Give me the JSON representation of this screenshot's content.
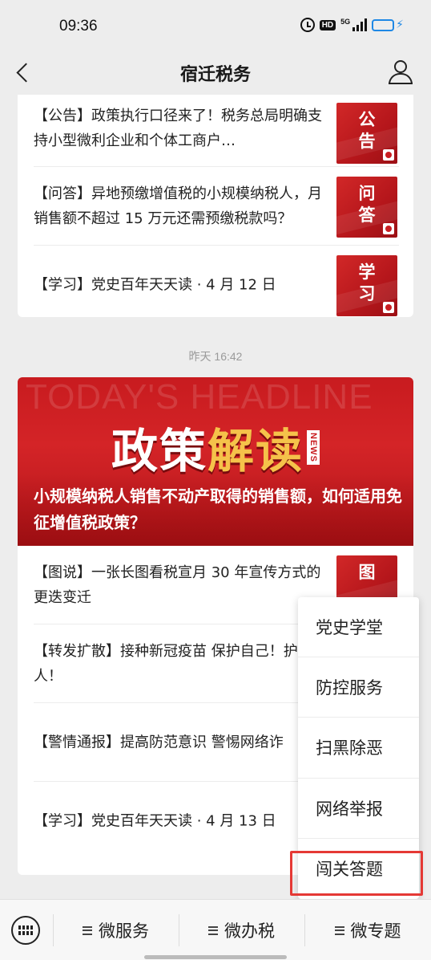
{
  "status_bar": {
    "time": "09:36",
    "hd_label": "HD",
    "network_label": "5G"
  },
  "nav": {
    "title": "宿迁税务"
  },
  "card1": {
    "articles": [
      {
        "title": "【公告】政策执行口径来了！税务总局明确支持小型微利企业和个体工商户…",
        "thumb": "公告"
      },
      {
        "title": "【问答】异地预缴增值税的小规模纳税人，月销售额不超过 15 万元还需预缴税款吗？",
        "thumb": "问答"
      },
      {
        "title": "【学习】党史百年天天读 · 4 月 12 日",
        "thumb": "学习"
      }
    ]
  },
  "timestamp": "昨天 16:42",
  "hero": {
    "bg_text": "TODAY'S HEADLINE",
    "logo_white": "政策",
    "logo_gold": "解读",
    "logo_badge": "NEWS",
    "title": "小规模纳税人销售不动产取得的销售额，如何适用免征增值税政策？"
  },
  "card2": {
    "articles": [
      {
        "title": "【图说】一张长图看税宣月 30 年宣传方式的更迭变迁",
        "thumb": "图"
      },
      {
        "title": "【转发扩散】接种新冠疫苗 保护自己！护家人！"
      },
      {
        "title": "【警情通报】提高防范意识  警惕网络诈"
      },
      {
        "title": "【学习】党史百年天天读 · 4 月 13 日"
      }
    ]
  },
  "popup_menu": {
    "items": [
      "党史学堂",
      "防控服务",
      "扫黑除恶",
      "网络举报",
      "闯关答题"
    ]
  },
  "bottom_bar": {
    "tabs": [
      "微服务",
      "微办税",
      "微专题"
    ]
  },
  "colors": {
    "accent_red": "#c81b1f",
    "highlight_red": "#e53935",
    "gold": "#f5c24a",
    "battery_blue": "#1e88e5"
  },
  "icons": [
    "back-arrow-icon",
    "user-profile-icon",
    "keyboard-icon",
    "menu-lines-icon",
    "alarm-icon",
    "signal-icon",
    "battery-icon"
  ]
}
